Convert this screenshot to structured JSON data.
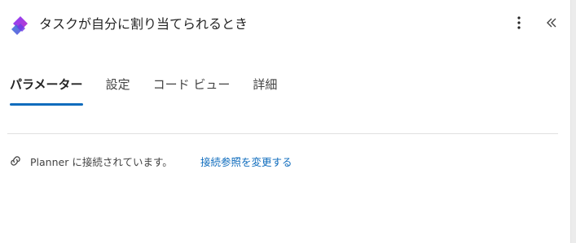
{
  "header": {
    "title": "タスクが自分に割り当てられるとき",
    "app_icon": "planner-logo-icon",
    "more_icon": "more-vertical-icon",
    "collapse_icon": "double-chevron-left-icon"
  },
  "tabs": [
    {
      "label": "パラメーター",
      "active": true
    },
    {
      "label": "設定",
      "active": false
    },
    {
      "label": "コード ビュー",
      "active": false
    },
    {
      "label": "詳細",
      "active": false
    }
  ],
  "connection": {
    "icon": "link-icon",
    "text": "Planner に接続されています。",
    "change_link": "接続参照を変更する"
  },
  "colors": {
    "accent": "#0f6cbd",
    "text": "#242424",
    "divider": "#e0e0e0"
  }
}
